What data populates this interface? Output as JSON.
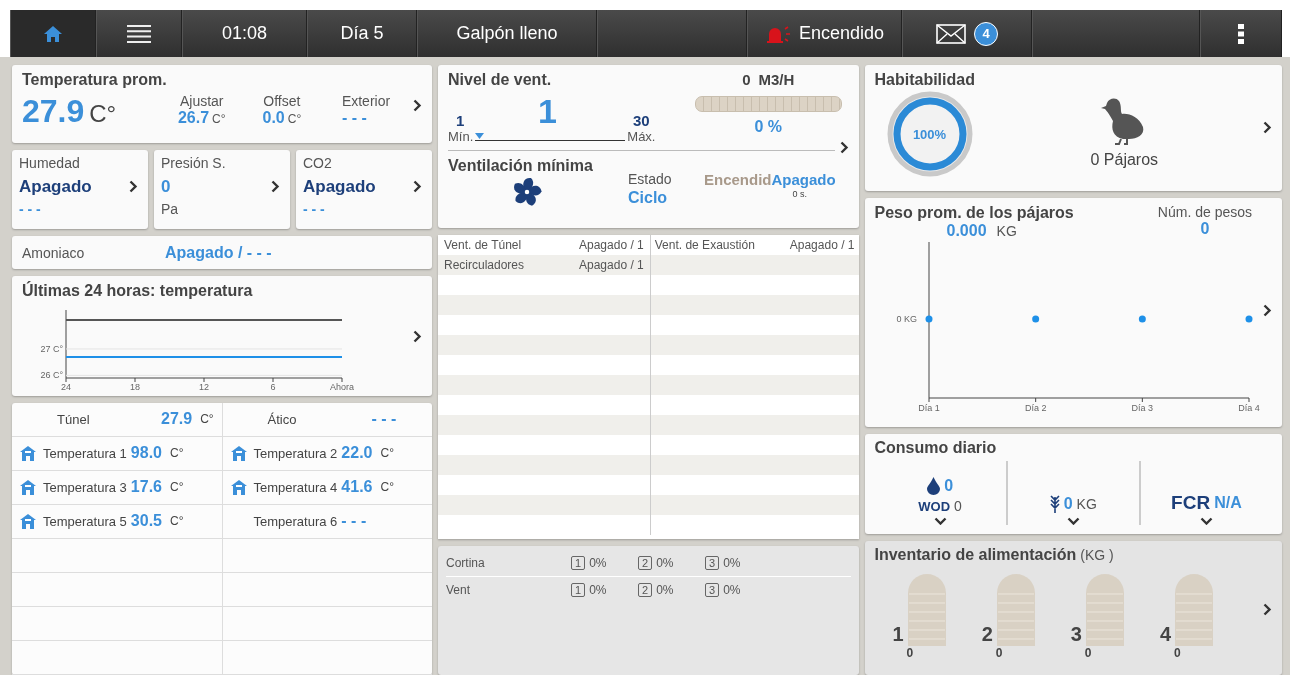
{
  "top_bar": {
    "nav": [
      {
        "kind": "home",
        "selected": true
      },
      {
        "kind": "menu",
        "selected": false
      }
    ],
    "time": "01:08",
    "day": "Día 5",
    "status": "Galpón lleno",
    "alarm": "Encendido",
    "messages": "4"
  },
  "temperature": {
    "title": "Temperatura prom.",
    "value": "27.9",
    "unit": "C°",
    "fields": [
      {
        "label": "Ajustar",
        "value": "26.7",
        "unit": "C°"
      },
      {
        "label": "Offset",
        "value": "0.0",
        "unit": "C°"
      },
      {
        "label": "Exterior",
        "value": "- - -"
      }
    ]
  },
  "sensors": [
    {
      "kind": "status",
      "label": "Humedad",
      "value": "Apagado",
      "sub": "- - -"
    },
    {
      "kind": "reading",
      "label": "Presión S.",
      "value": "0",
      "sub": "Pa"
    },
    {
      "kind": "status",
      "label": "CO2",
      "value": "Apagado",
      "sub": "- - -"
    }
  ],
  "ammonia": {
    "label": "Amoniaco",
    "value": "Apagado / - - -"
  },
  "history": {
    "title": "Últimas 24 horas: temperatura",
    "chart_data": {
      "type": "line",
      "categories": [
        "24",
        "18",
        "12",
        "6",
        "Ahora"
      ],
      "series": [
        {
          "color": "#555555",
          "values": [
            28.1,
            28.1,
            28.1,
            28.1,
            28.1
          ]
        },
        {
          "color": "#1e90e8",
          "values": [
            26.7,
            26.7,
            26.7,
            26.7,
            26.7
          ]
        }
      ],
      "ylim": [
        25.9,
        28.4
      ],
      "yticks": [
        {
          "value": 26,
          "label": "26 C°"
        },
        {
          "value": 27,
          "label": "27 C°"
        }
      ]
    }
  },
  "sensor_table": [
    [
      {
        "kind": "plain",
        "label": "Túnel",
        "value": "27.9",
        "unit": "C°"
      },
      {
        "kind": "plain",
        "label": "Ático",
        "value": "- - -"
      }
    ],
    [
      {
        "kind": "sensor",
        "label": "Temperatura 1",
        "value": "98.0",
        "unit": "C°"
      },
      {
        "kind": "sensor",
        "label": "Temperatura 2",
        "value": "22.0",
        "unit": "C°"
      }
    ],
    [
      {
        "kind": "sensor",
        "label": "Temperatura 3",
        "value": "17.6",
        "unit": "C°"
      },
      {
        "kind": "sensor",
        "label": "Temperatura 4",
        "value": "41.6",
        "unit": "C°"
      }
    ],
    [
      {
        "kind": "sensor",
        "label": "Temperatura 5",
        "value": "30.5",
        "unit": "C°"
      },
      {
        "kind": "plain",
        "label": "Temperatura 6",
        "value": "- - -"
      }
    ]
  ],
  "ventilation": {
    "title": "Nivel de vent.",
    "level_value": "1",
    "min": "1",
    "min_label": "Mín.",
    "max": "30",
    "max_label": "Máx.",
    "slider": {
      "level": 0
    },
    "flow": "0",
    "flow_unit": "M3/H",
    "flow_bar": {
      "level": 0
    },
    "percent": "0 %"
  },
  "min_vent": {
    "title": "Ventilación mínima",
    "state_label": "Estado",
    "state": "Ciclo",
    "on_label": "Encendid",
    "off_label": "Apagado",
    "timer": "0 s."
  },
  "devices": [
    [
      "Vent. de Túnel",
      "Apagado / 1",
      "Vent. de Exaustión",
      "Apagado / 1"
    ],
    [
      "Recirculadores",
      "Apagado / 1"
    ]
  ],
  "curtains": [
    {
      "label": "Cortina",
      "items": [
        {
          "num": "1",
          "value": "0%"
        },
        {
          "num": "2",
          "value": "0%"
        },
        {
          "num": "3",
          "value": "0%"
        }
      ]
    },
    {
      "label": "Vent",
      "items": [
        {
          "num": "1",
          "value": "0%"
        },
        {
          "num": "2",
          "value": "0%"
        },
        {
          "num": "3",
          "value": "0%"
        }
      ]
    }
  ],
  "habitability": {
    "title": "Habitabilidad",
    "percent": "100%",
    "level": 1,
    "birds": "0 Pájaros"
  },
  "weight": {
    "title": "Peso prom. de los pájaros",
    "value": "0.000",
    "unit": "KG",
    "count_label": "Núm. de pesos",
    "count": "0",
    "chart": {
      "y_label": "0 KG",
      "x_labels": [
        "Día 1",
        "Día 2",
        "Día 3",
        "Día 4"
      ]
    }
  },
  "consumption": {
    "title": "Consumo diario",
    "water": "0",
    "wod_label": "WOD",
    "wod": "0",
    "feed": "0",
    "feed_unit": "KG",
    "fcr_label": "FCR",
    "fcr": "N/A"
  },
  "inventory": {
    "title": "Inventario de alimentación",
    "unit": "(KG )",
    "silos": [
      {
        "num": "1",
        "amount": "0"
      },
      {
        "num": "2",
        "amount": "0"
      },
      {
        "num": "3",
        "amount": "0"
      },
      {
        "num": "4",
        "amount": "0"
      }
    ]
  }
}
